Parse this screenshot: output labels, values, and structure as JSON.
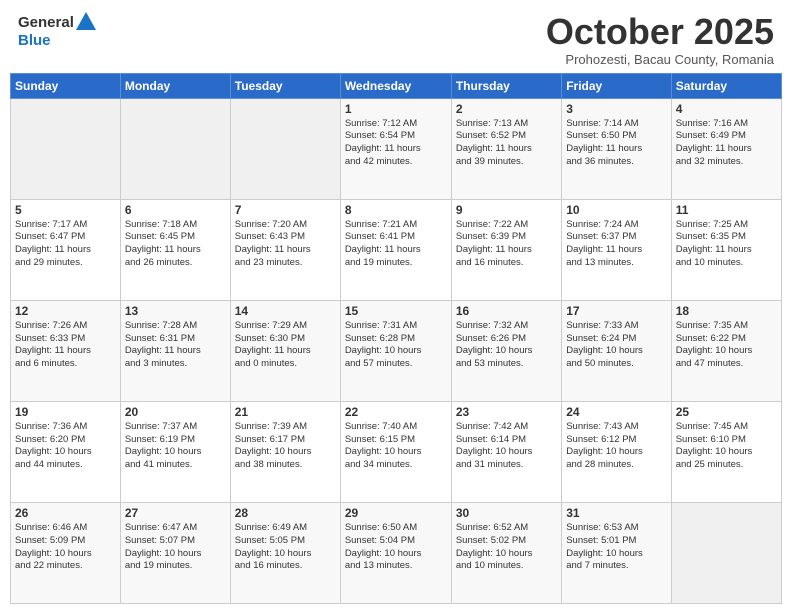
{
  "header": {
    "logo_general": "General",
    "logo_blue": "Blue",
    "month_title": "October 2025",
    "subtitle": "Prohozesti, Bacau County, Romania"
  },
  "days_of_week": [
    "Sunday",
    "Monday",
    "Tuesday",
    "Wednesday",
    "Thursday",
    "Friday",
    "Saturday"
  ],
  "weeks": [
    [
      {
        "num": "",
        "info": ""
      },
      {
        "num": "",
        "info": ""
      },
      {
        "num": "",
        "info": ""
      },
      {
        "num": "1",
        "info": "Sunrise: 7:12 AM\nSunset: 6:54 PM\nDaylight: 11 hours\nand 42 minutes."
      },
      {
        "num": "2",
        "info": "Sunrise: 7:13 AM\nSunset: 6:52 PM\nDaylight: 11 hours\nand 39 minutes."
      },
      {
        "num": "3",
        "info": "Sunrise: 7:14 AM\nSunset: 6:50 PM\nDaylight: 11 hours\nand 36 minutes."
      },
      {
        "num": "4",
        "info": "Sunrise: 7:16 AM\nSunset: 6:49 PM\nDaylight: 11 hours\nand 32 minutes."
      }
    ],
    [
      {
        "num": "5",
        "info": "Sunrise: 7:17 AM\nSunset: 6:47 PM\nDaylight: 11 hours\nand 29 minutes."
      },
      {
        "num": "6",
        "info": "Sunrise: 7:18 AM\nSunset: 6:45 PM\nDaylight: 11 hours\nand 26 minutes."
      },
      {
        "num": "7",
        "info": "Sunrise: 7:20 AM\nSunset: 6:43 PM\nDaylight: 11 hours\nand 23 minutes."
      },
      {
        "num": "8",
        "info": "Sunrise: 7:21 AM\nSunset: 6:41 PM\nDaylight: 11 hours\nand 19 minutes."
      },
      {
        "num": "9",
        "info": "Sunrise: 7:22 AM\nSunset: 6:39 PM\nDaylight: 11 hours\nand 16 minutes."
      },
      {
        "num": "10",
        "info": "Sunrise: 7:24 AM\nSunset: 6:37 PM\nDaylight: 11 hours\nand 13 minutes."
      },
      {
        "num": "11",
        "info": "Sunrise: 7:25 AM\nSunset: 6:35 PM\nDaylight: 11 hours\nand 10 minutes."
      }
    ],
    [
      {
        "num": "12",
        "info": "Sunrise: 7:26 AM\nSunset: 6:33 PM\nDaylight: 11 hours\nand 6 minutes."
      },
      {
        "num": "13",
        "info": "Sunrise: 7:28 AM\nSunset: 6:31 PM\nDaylight: 11 hours\nand 3 minutes."
      },
      {
        "num": "14",
        "info": "Sunrise: 7:29 AM\nSunset: 6:30 PM\nDaylight: 11 hours\nand 0 minutes."
      },
      {
        "num": "15",
        "info": "Sunrise: 7:31 AM\nSunset: 6:28 PM\nDaylight: 10 hours\nand 57 minutes."
      },
      {
        "num": "16",
        "info": "Sunrise: 7:32 AM\nSunset: 6:26 PM\nDaylight: 10 hours\nand 53 minutes."
      },
      {
        "num": "17",
        "info": "Sunrise: 7:33 AM\nSunset: 6:24 PM\nDaylight: 10 hours\nand 50 minutes."
      },
      {
        "num": "18",
        "info": "Sunrise: 7:35 AM\nSunset: 6:22 PM\nDaylight: 10 hours\nand 47 minutes."
      }
    ],
    [
      {
        "num": "19",
        "info": "Sunrise: 7:36 AM\nSunset: 6:20 PM\nDaylight: 10 hours\nand 44 minutes."
      },
      {
        "num": "20",
        "info": "Sunrise: 7:37 AM\nSunset: 6:19 PM\nDaylight: 10 hours\nand 41 minutes."
      },
      {
        "num": "21",
        "info": "Sunrise: 7:39 AM\nSunset: 6:17 PM\nDaylight: 10 hours\nand 38 minutes."
      },
      {
        "num": "22",
        "info": "Sunrise: 7:40 AM\nSunset: 6:15 PM\nDaylight: 10 hours\nand 34 minutes."
      },
      {
        "num": "23",
        "info": "Sunrise: 7:42 AM\nSunset: 6:14 PM\nDaylight: 10 hours\nand 31 minutes."
      },
      {
        "num": "24",
        "info": "Sunrise: 7:43 AM\nSunset: 6:12 PM\nDaylight: 10 hours\nand 28 minutes."
      },
      {
        "num": "25",
        "info": "Sunrise: 7:45 AM\nSunset: 6:10 PM\nDaylight: 10 hours\nand 25 minutes."
      }
    ],
    [
      {
        "num": "26",
        "info": "Sunrise: 6:46 AM\nSunset: 5:09 PM\nDaylight: 10 hours\nand 22 minutes."
      },
      {
        "num": "27",
        "info": "Sunrise: 6:47 AM\nSunset: 5:07 PM\nDaylight: 10 hours\nand 19 minutes."
      },
      {
        "num": "28",
        "info": "Sunrise: 6:49 AM\nSunset: 5:05 PM\nDaylight: 10 hours\nand 16 minutes."
      },
      {
        "num": "29",
        "info": "Sunrise: 6:50 AM\nSunset: 5:04 PM\nDaylight: 10 hours\nand 13 minutes."
      },
      {
        "num": "30",
        "info": "Sunrise: 6:52 AM\nSunset: 5:02 PM\nDaylight: 10 hours\nand 10 minutes."
      },
      {
        "num": "31",
        "info": "Sunrise: 6:53 AM\nSunset: 5:01 PM\nDaylight: 10 hours\nand 7 minutes."
      },
      {
        "num": "",
        "info": ""
      }
    ]
  ]
}
